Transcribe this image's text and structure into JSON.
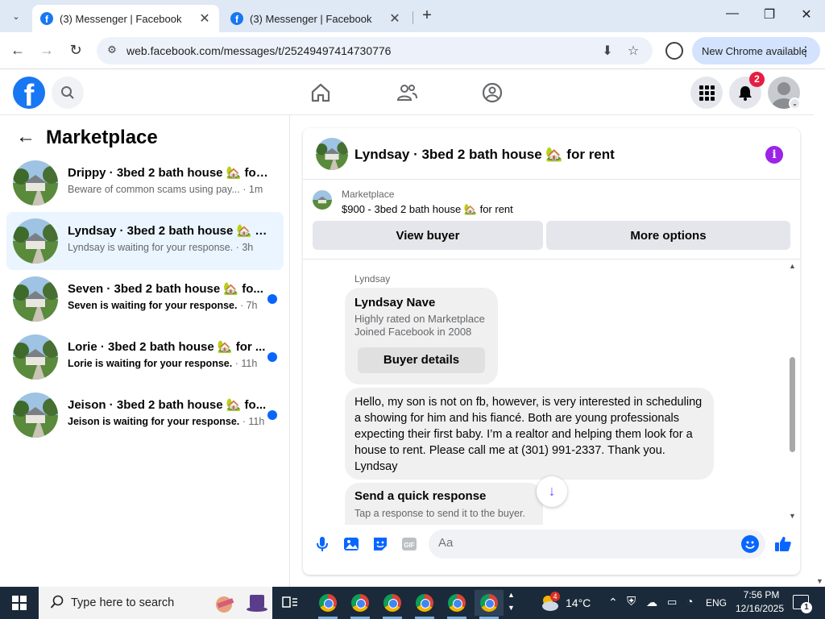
{
  "browser": {
    "tabs": [
      {
        "title": "(3) Messenger | Facebook",
        "active": true
      },
      {
        "title": "(3) Messenger | Facebook",
        "active": false
      }
    ],
    "url": "web.facebook.com/messages/t/25249497414730776",
    "update_label": "New Chrome available",
    "window_controls": {
      "minimize": "—",
      "maximize": "❐",
      "close": "✕"
    }
  },
  "fb": {
    "notification_count": "2",
    "logo_letter": "f"
  },
  "sidebar": {
    "title": "Marketplace",
    "conversations": [
      {
        "name": "Drippy · 3bed 2 bath house 🏡 for ...",
        "preview": "Beware of common scams using pay...",
        "time": "· 1m",
        "unread": false,
        "active": false
      },
      {
        "name": "Lyndsay · 3bed 2 bath house 🏡 fo...",
        "preview": "Lyndsay is waiting for your response.",
        "time": "· 3h",
        "unread": false,
        "active": true
      },
      {
        "name": "Seven · 3bed 2 bath house 🏡 fo...",
        "preview": "Seven is waiting for your response.",
        "time": "· 7h",
        "unread": true,
        "active": false
      },
      {
        "name": "Lorie · 3bed 2 bath house 🏡 for ...",
        "preview": "Lorie is waiting for your response.",
        "time": "· 11h",
        "unread": true,
        "active": false
      },
      {
        "name": "Jeison · 3bed 2 bath house 🏡 fo...",
        "preview": "Jeison is waiting for your response.",
        "time": "· 11h",
        "unread": true,
        "active": false
      }
    ]
  },
  "chat": {
    "header_title": "Lyndsay · 3bed 2 bath house 🏡 for rent",
    "listing_source": "Marketplace",
    "listing_title": "$900 - 3bed 2 bath house 🏡 for rent",
    "view_buyer_label": "View buyer",
    "more_options_label": "More options",
    "sender_name": "Lyndsay",
    "buyer_card": {
      "name": "Lyndsay Nave",
      "line1": "Highly rated on Marketplace",
      "line2": "Joined Facebook in 2008",
      "button": "Buyer details"
    },
    "message": "Hello, my son is not on fb, however, is very interested in scheduling a showing for him and his fiancé. Both are young professionals expecting their first baby. I’m a realtor and helping them look for a house to rent. Please call me at (301) 991-2337. Thank you. Lyndsay",
    "quick_response_title": "Send a quick response",
    "quick_response_sub": "Tap a response to send it to the buyer.",
    "composer_placeholder": "Aa"
  },
  "taskbar": {
    "search_placeholder": "Type here to search",
    "weather_temp": "14°C",
    "weather_badge": "4",
    "language": "ENG",
    "time": "7:56 PM",
    "date": "12/16/2025",
    "notification_count": "1"
  },
  "colors": {
    "fb_blue": "#1877f2",
    "messenger_purple": "#9b24e8",
    "unread_dot": "#0866ff",
    "active_conversation_bg": "#ebf5ff"
  }
}
